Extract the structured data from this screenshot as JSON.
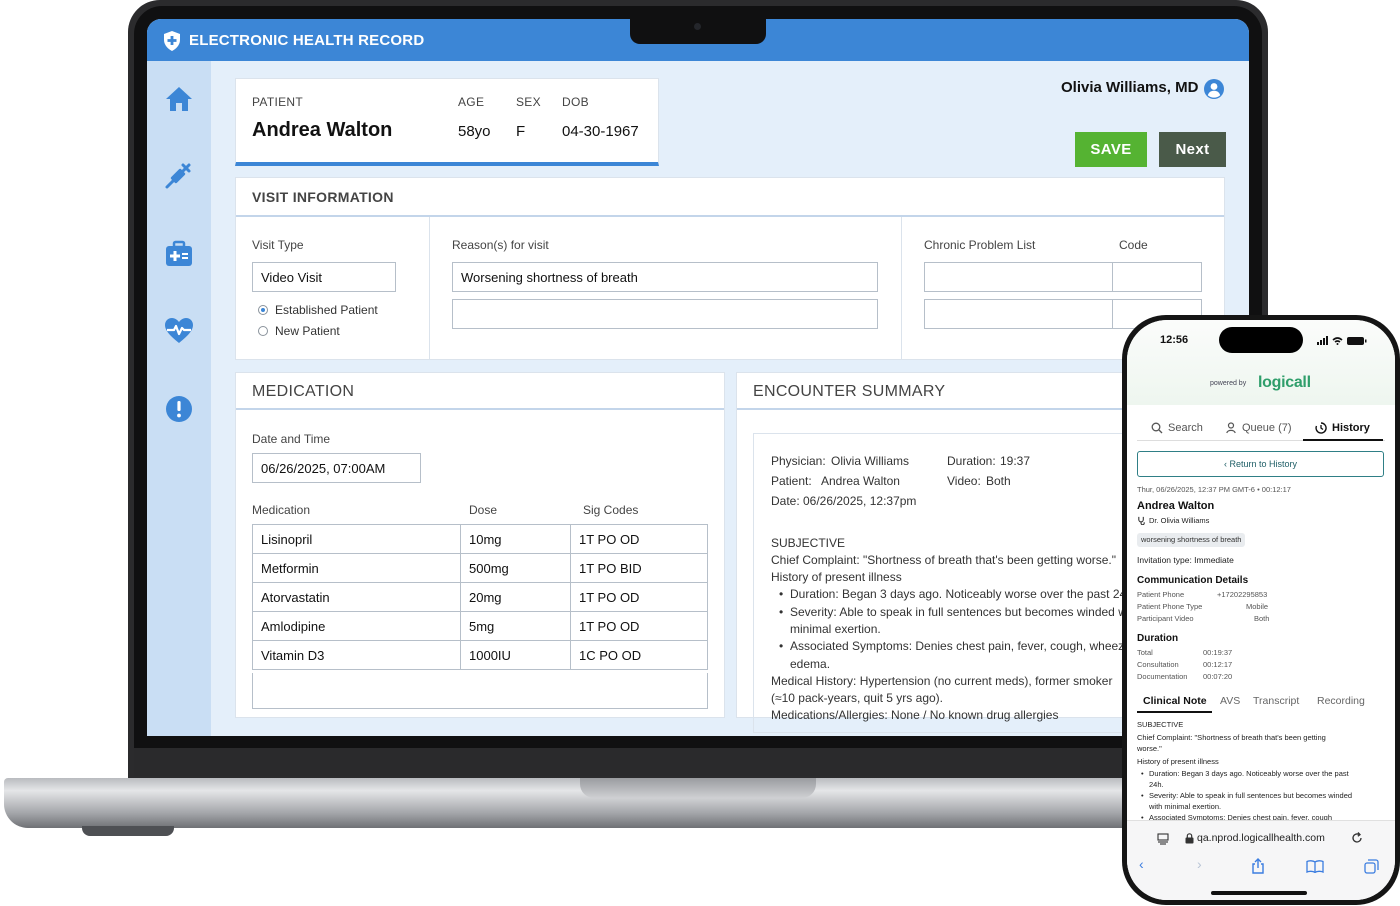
{
  "app": {
    "title": "ELECTRONIC HEALTH RECORD",
    "sidebar_icons": [
      "home-icon",
      "syringe-icon",
      "medical-kit-icon",
      "heart-pulse-icon",
      "alert-icon"
    ],
    "user_name": "Olivia Williams, MD",
    "save_label": "SAVE",
    "next_label": "Next",
    "colors": {
      "topbar": "#3c86d6",
      "save": "#55b332",
      "next": "#4a5a49",
      "sidebar": "#c9def4"
    }
  },
  "patient": {
    "label_patient": "PATIENT",
    "label_age": "AGE",
    "label_sex": "SEX",
    "label_dob": "DOB",
    "name": "Andrea Walton",
    "age": "58yo",
    "sex": "F",
    "dob": "04-30-1967"
  },
  "visit": {
    "title": "VISIT INFORMATION",
    "visit_type_label": "Visit Type",
    "visit_type_value": "Video Visit",
    "radio_established": "Established Patient",
    "radio_new": "New Patient",
    "reason_label": "Reason(s) for visit",
    "reason_1": "Worsening shortness of breath",
    "reason_2": "",
    "chronic_label": "Chronic Problem List",
    "code_label": "Code"
  },
  "medication": {
    "title": "MEDICATION",
    "date_label": "Date and Time",
    "date_value": "06/26/2025, 07:00AM",
    "col_med": "Medication",
    "col_dose": "Dose",
    "col_sig": "Sig Codes",
    "rows": [
      {
        "name": "Lisinopril",
        "dose": "10mg",
        "sig": "1T PO OD"
      },
      {
        "name": "Metformin",
        "dose": "500mg",
        "sig": "1T PO BID"
      },
      {
        "name": "Atorvastatin",
        "dose": "20mg",
        "sig": "1T PO OD"
      },
      {
        "name": "Amlodipine",
        "dose": "5mg",
        "sig": "1T PO OD"
      },
      {
        "name": "Vitamin D3",
        "dose": "1000IU",
        "sig": "1C PO OD"
      }
    ]
  },
  "encounter": {
    "title": "ENCOUNTER SUMMARY",
    "physician_label": "Physician:",
    "physician": "Olivia Williams",
    "duration_label": "Duration:",
    "duration": "19:37",
    "patient_label": "Patient:",
    "patient": "Andrea Walton",
    "video_label": "Video:",
    "video": "Both",
    "date_label": "Date:",
    "date": "06/26/2025, 12:37pm",
    "subjective": "SUBJECTIVE",
    "chief_complaint": "Chief Complaint: \"Shortness of breath that's been getting worse.\"",
    "hpi": "History of present illness",
    "bullet_1": "Duration: Began 3 days ago. Noticeably worse over the past 24h.",
    "bullet_2a": "Severity: Able to speak in full sentences but becomes winded with",
    "bullet_2b": "minimal exertion.",
    "bullet_3a": "Associated Symptoms: Denies chest pain, fever, cough, wheezing or",
    "bullet_3b": "edema.",
    "medical_history_a": "Medical History: Hypertension (no current meds), former smoker",
    "medical_history_b": "(≈10 pack-years, quit 5 yrs ago).",
    "medications_line": "Medications/Allergies: None / No known drug allergies"
  },
  "phone": {
    "time": "12:56",
    "powered_by": "powered by",
    "brand": "logicall",
    "tab_search": "Search",
    "tab_queue": "Queue (7)",
    "tab_history": "History",
    "return_label": "Return to History",
    "timestamp": "Thur, 06/26/2025, 12:37 PM GMT-6  •  00:12:17",
    "patient_name": "Andrea Walton",
    "doctor": "Dr. Olivia Williams",
    "reason_chip": "worsening shortness of breath",
    "invitation": "Invitation type: Immediate",
    "comm_title": "Communication Details",
    "comm_rows": [
      {
        "label": "Patient Phone",
        "value": "+17202295853"
      },
      {
        "label": "Patient Phone Type",
        "value": "Mobile"
      },
      {
        "label": "Participant Video",
        "value": "Both"
      }
    ],
    "duration_title": "Duration",
    "duration_rows": [
      {
        "label": "Total",
        "value": "00:19:37"
      },
      {
        "label": "Consultation",
        "value": "00:12:17"
      },
      {
        "label": "Documentation",
        "value": "00:07:20"
      }
    ],
    "subtabs": [
      "Clinical Note",
      "AVS",
      "Transcript",
      "Recording"
    ],
    "note_subjective": "SUBJECTIVE",
    "note_cc_a": "Chief Complaint: \"Shortness of breath that's been getting",
    "note_cc_b": "worse.\"",
    "note_hpi": "History of present illness",
    "note_b1a": "Duration: Began 3 days ago. Noticeably worse over the past",
    "note_b1b": "24h.",
    "note_b2a": "Severity: Able to speak in full sentences but becomes winded",
    "note_b2b": "with minimal exertion.",
    "note_b3": "Associated Symptoms: Denies chest pain, fever, cough",
    "url": "qa.nprod.logicallhealth.com"
  }
}
